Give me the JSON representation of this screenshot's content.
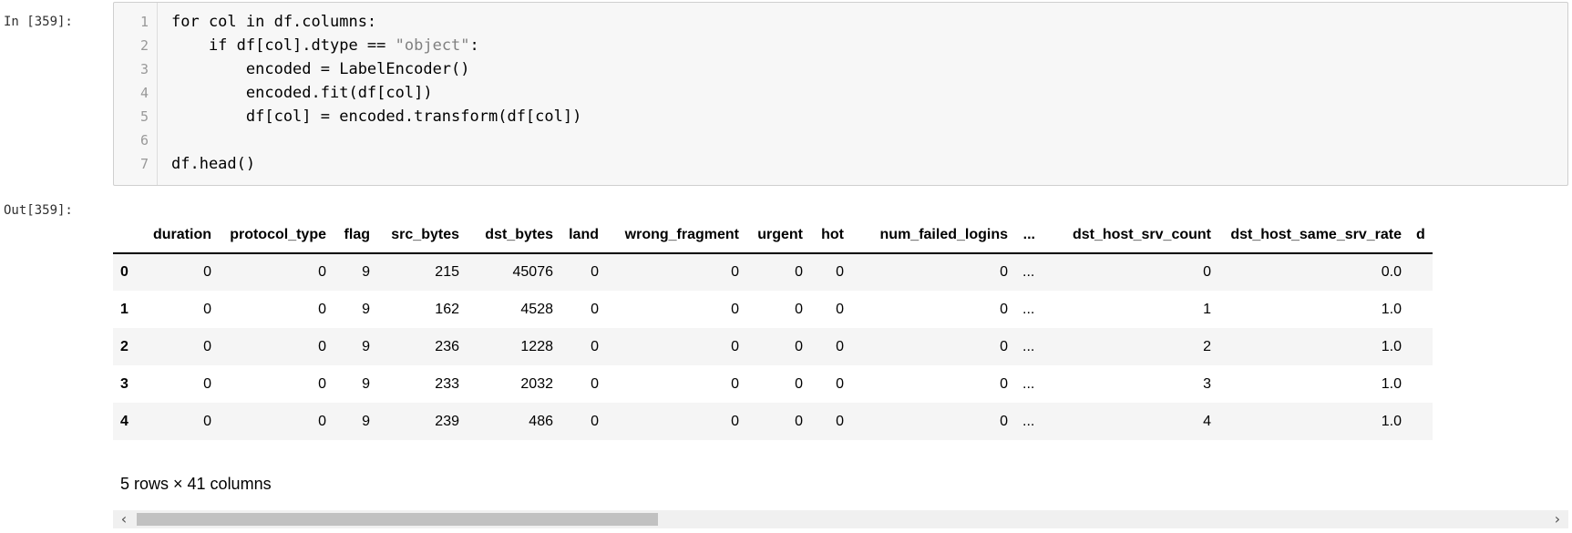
{
  "cell": {
    "in_prompt": "In [359]:",
    "out_prompt": "Out[359]:",
    "code_lines": [
      {
        "num": "1",
        "text": "for col in df.columns:"
      },
      {
        "num": "2",
        "pre": "    if df[col].dtype == ",
        "str": "\"object\"",
        "post": ":"
      },
      {
        "num": "3",
        "text": "        encoded = LabelEncoder()"
      },
      {
        "num": "4",
        "text": "        encoded.fit(df[col])"
      },
      {
        "num": "5",
        "text": "        df[col] = encoded.transform(df[col])"
      },
      {
        "num": "6",
        "text": ""
      },
      {
        "num": "7",
        "text": "df.head()"
      }
    ]
  },
  "table": {
    "columns": [
      "",
      "duration",
      "protocol_type",
      "flag",
      "src_bytes",
      "dst_bytes",
      "land",
      "wrong_fragment",
      "urgent",
      "hot",
      "num_failed_logins",
      "...",
      "dst_host_srv_count",
      "dst_host_same_srv_rate",
      "d"
    ],
    "rows": [
      [
        "0",
        "0",
        "0",
        "9",
        "215",
        "45076",
        "0",
        "0",
        "0",
        "0",
        "0",
        "...",
        "0",
        "0.0",
        ""
      ],
      [
        "1",
        "0",
        "0",
        "9",
        "162",
        "4528",
        "0",
        "0",
        "0",
        "0",
        "0",
        "...",
        "1",
        "1.0",
        ""
      ],
      [
        "2",
        "0",
        "0",
        "9",
        "236",
        "1228",
        "0",
        "0",
        "0",
        "0",
        "0",
        "...",
        "2",
        "1.0",
        ""
      ],
      [
        "3",
        "0",
        "0",
        "9",
        "233",
        "2032",
        "0",
        "0",
        "0",
        "0",
        "0",
        "...",
        "3",
        "1.0",
        ""
      ],
      [
        "4",
        "0",
        "0",
        "9",
        "239",
        "486",
        "0",
        "0",
        "0",
        "0",
        "0",
        "...",
        "4",
        "1.0",
        ""
      ]
    ],
    "shape_text": "5 rows × 41 columns"
  },
  "scrollbar": {
    "left_arrow": "‹",
    "right_arrow": "›",
    "thumb_fraction": 0.37
  }
}
